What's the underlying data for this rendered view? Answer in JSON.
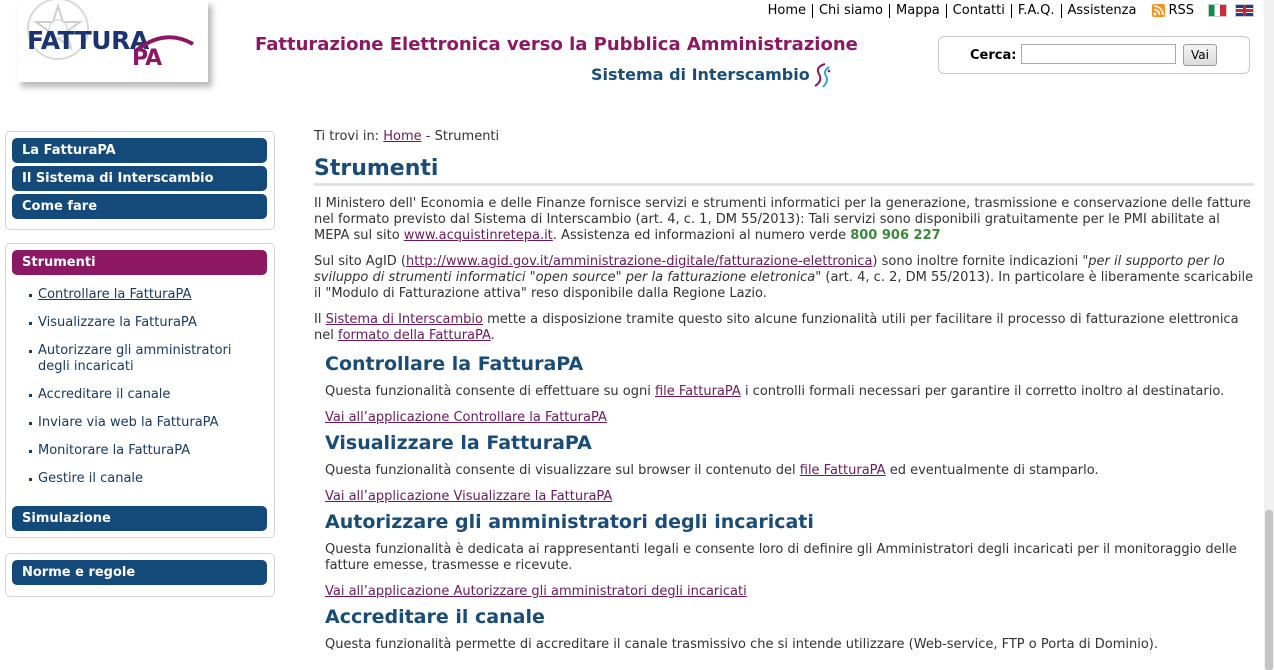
{
  "header": {
    "logo_text": "FATTURA",
    "logo_suffix": "PA",
    "title": "Fatturazione Elettronica verso la Pubblica Amministrazione",
    "subtitle": "Sistema di Interscambio",
    "brand_colors": {
      "primary": "#8c1864",
      "navy": "#134a7a",
      "title_blue": "#1a4c78"
    }
  },
  "topnav": {
    "items": [
      "Home",
      "Chi siamo",
      "Mappa",
      "Contatti",
      "F.A.Q.",
      "Assistenza"
    ],
    "rss_label": "RSS",
    "languages": [
      "it-flag-icon",
      "en-flag-icon"
    ]
  },
  "search": {
    "label": "Cerca:",
    "value": "",
    "button_label": "Vai"
  },
  "sidebar": {
    "group1": [
      "La FatturaPA",
      "Il Sistema di Interscambio",
      "Come fare"
    ],
    "active_label": "Strumenti",
    "sub_items": [
      "Controllare la FatturaPA",
      "Visualizzare la FatturaPA",
      "Autorizzare gli amministratori degli incaricati",
      "Accreditare il canale",
      "Inviare via web la FatturaPA",
      "Monitorare la FatturaPA",
      "Gestire il canale"
    ],
    "simulazione_label": "Simulazione",
    "norme_label": "Norme e regole"
  },
  "breadcrumb": {
    "prefix": "Ti trovi in:",
    "home": "Home",
    "separator": "-",
    "current": "Strumenti"
  },
  "page": {
    "title": "Strumenti",
    "intro1_a": "Il Ministero dell' Economia e delle Finanze fornisce servizi e strumenti informatici per la generazione, trasmissione e conservazione delle fatture nel formato previsto dal Sistema di Interscambio (art. 4, c. 1, DM 55/2013): Tali servizi sono disponibili gratuitamente per le PMI abilitate al MEPA sul sito",
    "intro1_link": "www.acquistinretepa.it",
    "intro1_b": ". Assistenza ed informazioni al numero verde",
    "intro1_phone": "800 906 227",
    "intro2_a": "Sul sito AgID (",
    "intro2_link": "http://www.agid.gov.it/amministrazione-digitale/fatturazione-elettronica",
    "intro2_b": ") sono inoltre fornite indicazioni",
    "intro2_quote": "\"per il supporto per lo sviluppo di strumenti informatici \"open source\" per la fatturazione eletronica\"",
    "intro2_c": "(art. 4, c. 2, DM 55/2013). In particolare è liberamente scaricabile il \"Modulo di Fatturazione attiva\" reso disponibile dalla Regione Lazio.",
    "intro3_a": "Il",
    "intro3_link1": "Sistema di Interscambio",
    "intro3_b": "mette a disposizione tramite questo sito alcune funzionalità utili per facilitare il processo di fatturazione elettronica nel",
    "intro3_link2": "formato della FatturaPA",
    "intro3_c": "."
  },
  "sections": [
    {
      "title": "Controllare la FatturaPA",
      "desc_a": "Questa funzionalità consente di effettuare su ogni",
      "desc_link": "file FatturaPA",
      "desc_b": "i controlli formali necessari per garantire il corretto inoltro al destinatario.",
      "app_link": "Vai all’applicazione Controllare la FatturaPA"
    },
    {
      "title": "Visualizzare la FatturaPA",
      "desc_a": "Questa funzionalità consente di visualizzare sul browser il contenuto del",
      "desc_link": "file FatturaPA",
      "desc_b": "ed eventualmente di stamparlo.",
      "app_link": "Vai all’applicazione Visualizzare la FatturaPA"
    },
    {
      "title": "Autorizzare gli amministratori degli incaricati",
      "desc": "Questa funzionalità è dedicata ai rappresentanti legali e consente loro di definire gli Amministratori degli incaricati per il monitoraggio delle fatture emesse, trasmesse e ricevute.",
      "app_link": "Vai all’applicazione Autorizzare gli amministratori degli incaricati"
    },
    {
      "title": "Accreditare il canale",
      "desc": "Questa funzionalità permette di accreditare il canale trasmissivo che si intende utilizzare (Web-service, FTP o Porta di Dominio)."
    }
  ]
}
